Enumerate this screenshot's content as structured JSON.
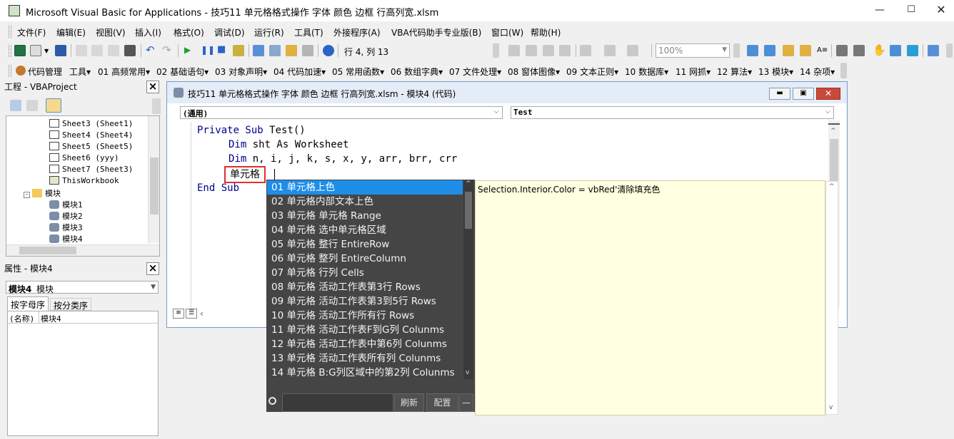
{
  "window": {
    "title": "Microsoft Visual Basic for Applications - 技巧11  单元格格式操作 字体 颜色 边框 行高列宽.xlsm"
  },
  "menu": [
    "文件(F)",
    "编辑(E)",
    "视图(V)",
    "插入(I)",
    "格式(O)",
    "调试(D)",
    "运行(R)",
    "工具(T)",
    "外接程序(A)",
    "VBA代码助手专业版(B)",
    "窗口(W)",
    "帮助(H)"
  ],
  "toolbar": {
    "position": "行 4, 列 13",
    "zoom": "100%"
  },
  "addin_toolbar": {
    "items": [
      "代码管理",
      "工具▾",
      "01 高频常用▾",
      "02 基础语句▾",
      "03 对象声明▾",
      "04 代码加速▾",
      "05 常用函数▾",
      "06 数组字典▾",
      "07 文件处理▾",
      "08 窗体图像▾",
      "09 文本正则▾",
      "10 数据库▾",
      "11 网抓▾",
      "12 算法▾",
      "13 模块▾",
      "14 杂项▾"
    ]
  },
  "project_panel": {
    "title": "工程 - VBAProject",
    "items": [
      "Sheet3 (Sheet1)",
      "Sheet4 (Sheet4)",
      "Sheet5 (Sheet5)",
      "Sheet6 (yyy)",
      "Sheet7 (Sheet3)",
      "ThisWorkbook",
      "模块",
      "模块1",
      "模块2",
      "模块3",
      "模块4"
    ]
  },
  "properties_panel": {
    "title": "属性 - 模块4",
    "object_bold": "模块4",
    "object_type": "模块",
    "tabs": [
      "按字母序",
      "按分类序"
    ],
    "row_name": "(名称)",
    "row_value": "模块4"
  },
  "code_window": {
    "title": "技巧11  单元格格式操作 字体 颜色 边框 行高列宽.xlsm - 模块4 (代码)",
    "object_combo": "(通用)",
    "proc_combo": "Test",
    "lines": [
      {
        "kw": "Private Sub ",
        "rest": "Test()"
      },
      {
        "kw": "Dim ",
        "rest": "sht As Worksheet"
      },
      {
        "kw": "Dim ",
        "rest": "n, i, j, k, s, x, y, arr, brr, crr"
      },
      {
        "kw": "",
        "rest": "单元格"
      },
      {
        "kw": "End Sub",
        "rest": ""
      }
    ]
  },
  "popup": {
    "items": [
      "01 单元格上色",
      "02 单元格内部文本上色",
      "03 单元格 单元格 Range",
      "04 单元格 选中单元格区域",
      "05 单元格 整行 EntireRow",
      "06 单元格 整列 EntireColumn",
      "07 单元格 行列 Cells",
      "08 单元格 活动工作表第3行 Rows",
      "09 单元格 活动工作表第3到5行 Rows",
      "10 单元格 活动工作所有行 Rows",
      "11 单元格 活动工作表F到G列 Colunms",
      "12 单元格 活动工作表中第6列 Colunms",
      "13 单元格 活动工作表所有列 Colunms",
      "14 单元格 B:G列区域中的第2列 Colunms"
    ],
    "refresh": "刷新",
    "config": "配置",
    "minus": "—",
    "hint": "Selection.Interior.Color = vbRed'清除填充色"
  },
  "colors": {
    "accent": "#1e8ee8",
    "keyword": "#00008b",
    "highlight_box": "#e0302a",
    "hint_bg": "#ffffe1"
  }
}
